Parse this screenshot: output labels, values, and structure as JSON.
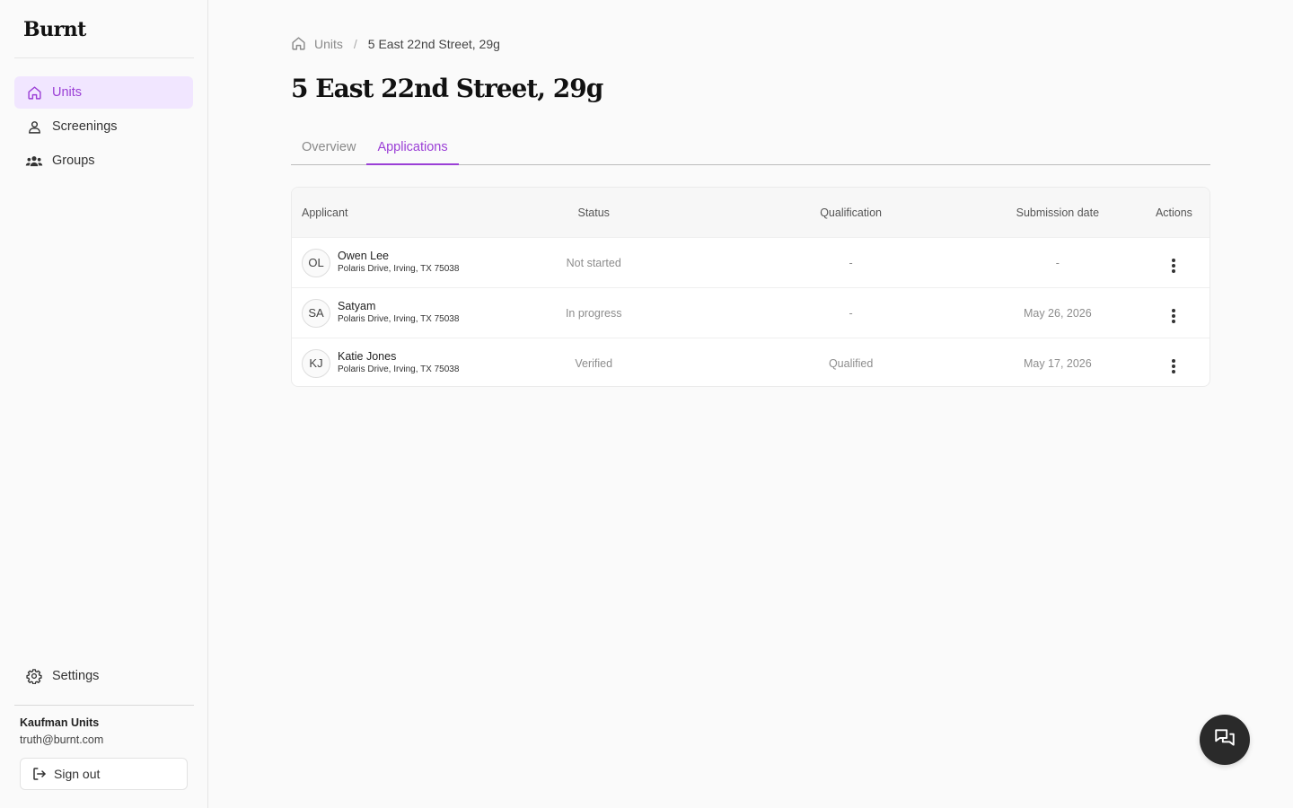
{
  "brand": {
    "logo_text": "Burnt",
    "accent": "#9b3fd6",
    "active_bg": "#f1e6ff"
  },
  "sidebar": {
    "items": [
      {
        "label": "Units",
        "icon": "home-icon",
        "active": true
      },
      {
        "label": "Screenings",
        "icon": "user-icon",
        "active": false
      },
      {
        "label": "Groups",
        "icon": "users-icon",
        "active": false
      }
    ],
    "settings_label": "Settings",
    "org_name": "Kaufman Units",
    "org_email": "truth@burnt.com",
    "signout_label": "Sign out"
  },
  "breadcrumb": {
    "parent": "Units",
    "current": "5 East 22nd Street, 29g"
  },
  "page_title": "5 East 22nd Street, 29g",
  "tabs": [
    {
      "label": "Overview",
      "active": false
    },
    {
      "label": "Applications",
      "active": true
    }
  ],
  "table": {
    "headers": {
      "applicant": "Applicant",
      "status": "Status",
      "qualification": "Qualification",
      "submission_date": "Submission date",
      "actions": "Actions"
    },
    "rows": [
      {
        "initials": "OL",
        "name": "Owen Lee",
        "address": "Polaris Drive, Irving, TX 75038",
        "status": "Not started",
        "qualification": "-",
        "submission_date": "-"
      },
      {
        "initials": "SA",
        "name": "Satyam",
        "address": "Polaris Drive, Irving, TX 75038",
        "status": "In progress",
        "qualification": "-",
        "submission_date": "May 26, 2026"
      },
      {
        "initials": "KJ",
        "name": "Katie Jones",
        "address": "Polaris Drive, Irving, TX 75038",
        "status": "Verified",
        "qualification": "Qualified",
        "submission_date": "May 17, 2026"
      }
    ]
  },
  "chat_button": {
    "icon": "chat-icon"
  }
}
